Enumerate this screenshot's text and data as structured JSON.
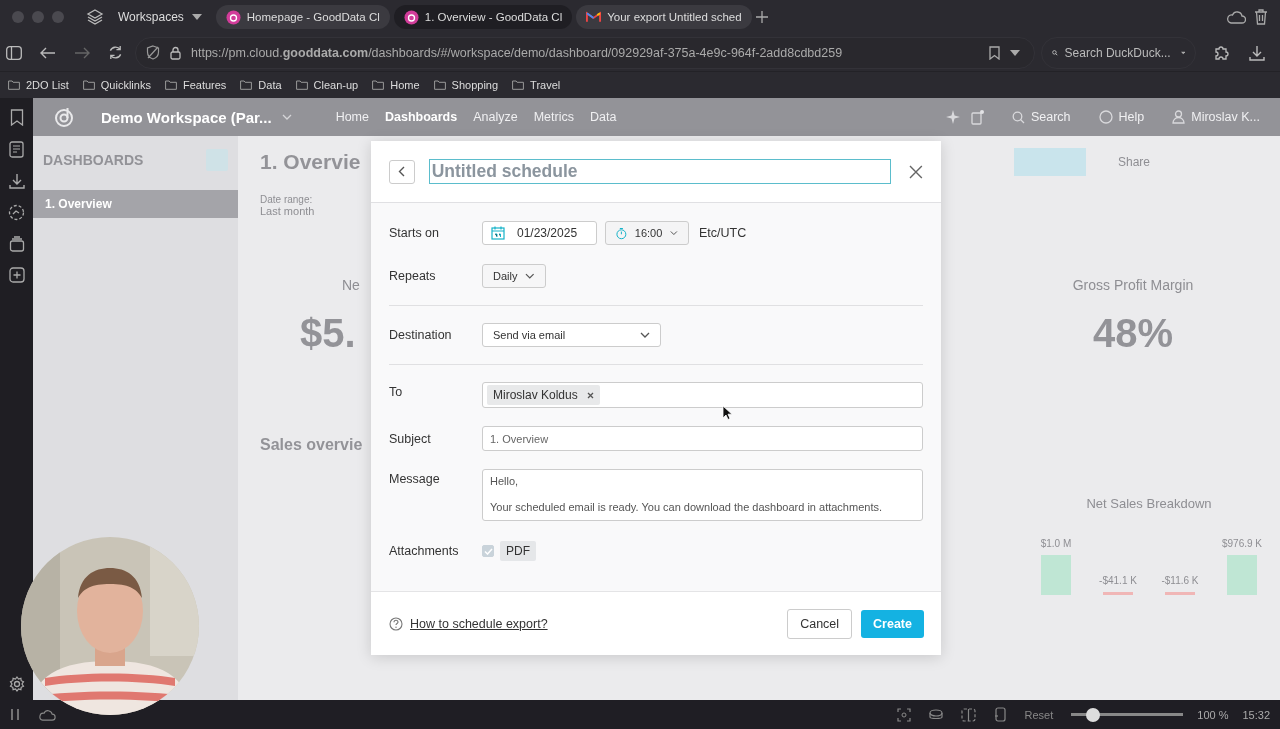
{
  "browser": {
    "workspaces": "Workspaces",
    "tabs": [
      {
        "title": "Homepage - GoodData Cl",
        "kind": "gooddata",
        "selected": false
      },
      {
        "title": "1. Overview - GoodData Cl",
        "kind": "gooddata",
        "selected": true
      },
      {
        "title": "Your export Untitled sched",
        "kind": "mail",
        "selected": false
      }
    ],
    "url": "https://pm.cloud.**gooddata.com**/dashboards/#/workspace/demo/dashboard/092929af-375a-4e9c-964f-2add8cdbd259",
    "search": {
      "placeholder": "Search DuckDuck..."
    },
    "bookmarks": [
      "2DO List",
      "Quicklinks",
      "Features",
      "Data",
      "Clean-up",
      "Home",
      "Shopping",
      "Travel"
    ]
  },
  "app": {
    "workspace": "Demo Workspace (Par...",
    "nav": [
      {
        "label": "Home",
        "selected": false
      },
      {
        "label": "Dashboards",
        "selected": true
      },
      {
        "label": "Analyze",
        "selected": false
      },
      {
        "label": "Metrics",
        "selected": false
      },
      {
        "label": "Data",
        "selected": false
      }
    ],
    "search": "Search",
    "help": "Help",
    "user": "Miroslav K...",
    "sidebar": {
      "title": "DASHBOARDS",
      "items": [
        {
          "label": "1. Overview",
          "selected": true
        }
      ]
    },
    "dashboard": {
      "title": "1. Overvie",
      "share": "Share",
      "filters": [
        {
          "label": "Date range:",
          "value": "Last month"
        }
      ],
      "kpis": [
        {
          "title": "Ne",
          "value": "$5."
        },
        {
          "title": "Gross Profit Margin",
          "value": "48%"
        }
      ],
      "section": "Sales overvie",
      "breakdown": {
        "title": "Net Sales Breakdown",
        "bar_labels": [
          "$1.0 M",
          "-$41.1 K",
          "-$11.6 K",
          "$976.9 K"
        ]
      }
    }
  },
  "schedule_dialog": {
    "title": {
      "placeholder": "Untitled schedule"
    },
    "starts_on": {
      "label": "Starts on",
      "date": "01/23/2025",
      "time": "16:00",
      "timezone": "Etc/UTC"
    },
    "repeats": {
      "label": "Repeats",
      "value": "Daily"
    },
    "destination": {
      "label": "Destination",
      "value": "Send via email"
    },
    "to": {
      "label": "To",
      "recipients": [
        "Miroslav Koldus"
      ]
    },
    "subject": {
      "label": "Subject",
      "placeholder": "1. Overview"
    },
    "message": {
      "label": "Message",
      "value": "Hello,\n\nYour scheduled email is ready. You can download the dashboard in attachments."
    },
    "attachments": {
      "label": "Attachments",
      "items": [
        {
          "label": "PDF",
          "checked": true
        }
      ]
    },
    "help_link": "How to schedule export?",
    "cancel": "Cancel",
    "create": "Create"
  },
  "status_bar": {
    "reset": "Reset",
    "zoom": {
      "level": 0.19
    },
    "zoom_label": "100 %",
    "time": "15:32"
  }
}
